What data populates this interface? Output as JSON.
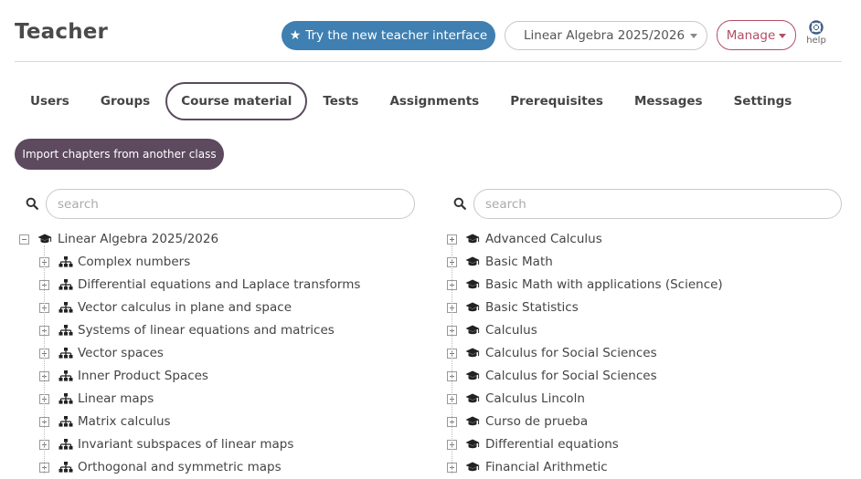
{
  "header": {
    "title": "Teacher",
    "try_button": "Try the new teacher interface",
    "course_selected": "Linear Algebra 2025/2026",
    "manage_button": "Manage",
    "help_label": "help"
  },
  "tabs": [
    {
      "label": "Users"
    },
    {
      "label": "Groups"
    },
    {
      "label": "Course material",
      "active": true
    },
    {
      "label": "Tests"
    },
    {
      "label": "Assignments"
    },
    {
      "label": "Prerequisites"
    },
    {
      "label": "Messages"
    },
    {
      "label": "Settings"
    }
  ],
  "import_button": "Import chapters from another class",
  "left_panel": {
    "search_placeholder": "search",
    "root": "Linear Algebra 2025/2026",
    "chapters": [
      "Complex numbers",
      "Differential equations and Laplace transforms",
      "Vector calculus in plane and space",
      "Systems of linear equations and matrices",
      "Vector spaces",
      "Inner Product Spaces",
      "Linear maps",
      "Matrix calculus",
      "Invariant subspaces of linear maps",
      "Orthogonal and symmetric maps"
    ]
  },
  "right_panel": {
    "search_placeholder": "search",
    "courses": [
      "Advanced Calculus",
      "Basic Math",
      "Basic Math with applications (Science)",
      "Basic Statistics",
      "Calculus",
      "Calculus for Social Sciences",
      "Calculus for Social Sciences",
      "Calculus Lincoln",
      "Curso de prueba",
      "Differential equations",
      "Financial Arithmetic"
    ]
  },
  "colors": {
    "primary_blue": "#3f7fb1",
    "accent_plum": "#5d4a5f",
    "manage_red": "#b24e66"
  },
  "icons": {
    "try_button": "star-icon",
    "help": "lifebuoy-icon",
    "search": "search-icon",
    "course": "graduation-cap-icon",
    "chapter": "sitemap-icon"
  }
}
